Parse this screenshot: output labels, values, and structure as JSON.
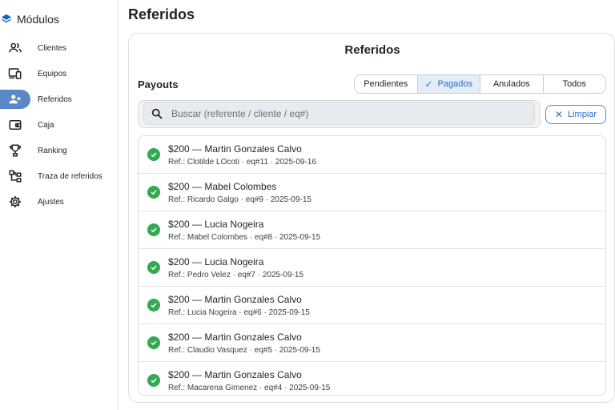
{
  "sidebar": {
    "title": "Módulos",
    "items": [
      {
        "label": "Clientes",
        "icon": "users-icon"
      },
      {
        "label": "Equipos",
        "icon": "devices-icon"
      },
      {
        "label": "Referidos",
        "icon": "user-add-icon",
        "active": true
      },
      {
        "label": "Caja",
        "icon": "wallet-icon"
      },
      {
        "label": "Ranking",
        "icon": "trophy-icon"
      },
      {
        "label": "Traza de referidos",
        "icon": "tree-icon"
      },
      {
        "label": "Ajustes",
        "icon": "gear-icon"
      }
    ]
  },
  "page": {
    "title": "Referidos"
  },
  "card": {
    "title": "Referidos",
    "section": "Payouts",
    "filters": [
      "Pendientes",
      "Pagados",
      "Anulados",
      "Todos"
    ],
    "selected_filter": "Pagados",
    "search_placeholder": "Buscar (referente / cliente / eq#)",
    "clear_label": "Limpiar"
  },
  "payouts": [
    {
      "title": "$200 — Martin Gonzales Calvo",
      "detail": "Ref.: Clotilde LOcoti · eq#11 · 2025-09-16"
    },
    {
      "title": "$200 — Mabel Colombes",
      "detail": "Ref.: Ricardo Galgo · eq#9 · 2025-09-15"
    },
    {
      "title": "$200 — Lucia Nogeira",
      "detail": "Ref.: Mabel Colombes · eq#8 · 2025-09-15"
    },
    {
      "title": "$200 — Lucia Nogeira",
      "detail": "Ref.: Pedro Velez · eq#7 · 2025-09-15"
    },
    {
      "title": "$200 — Martin Gonzales Calvo",
      "detail": "Ref.: Lucia Nogeira · eq#6 · 2025-09-15"
    },
    {
      "title": "$200 — Martin Gonzales Calvo",
      "detail": "Ref.: Claudio Vasquez · eq#5 · 2025-09-15"
    },
    {
      "title": "$200 — Martin Gonzales Calvo",
      "detail": "Ref.: Macarena Gimenez · eq#4 · 2025-09-15"
    }
  ],
  "colors": {
    "accent": "#2a6fc4",
    "active_nav": "#5b86c9",
    "success": "#34a853"
  }
}
